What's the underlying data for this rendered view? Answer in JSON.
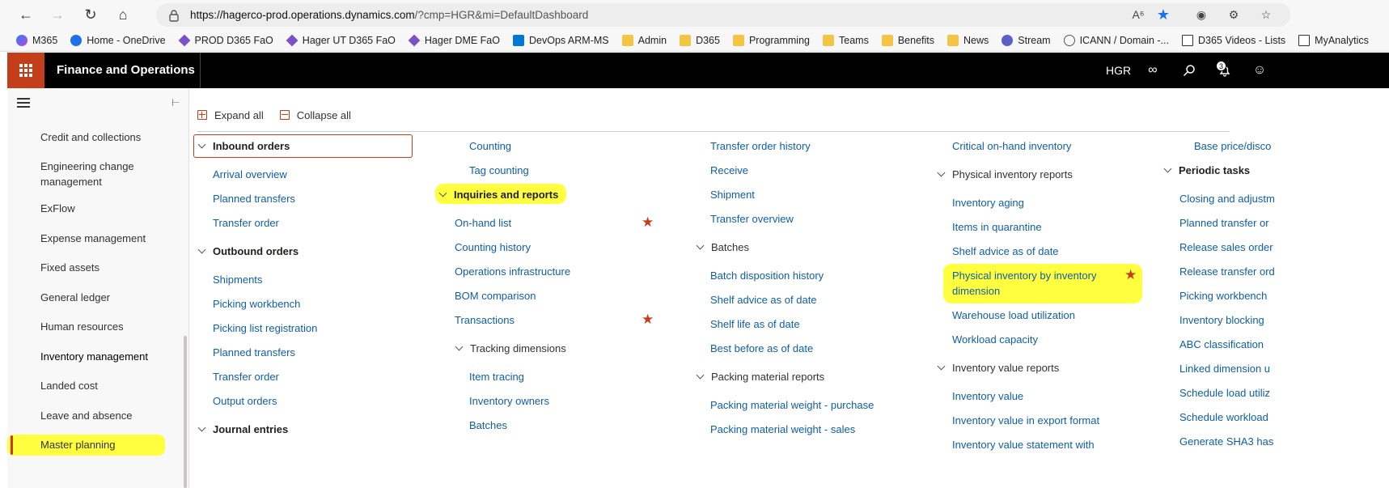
{
  "browser": {
    "url_host": "https://hagerco-prod.operations.dynamics.com",
    "url_path": "/?cmp=HGR&mi=DefaultDashboard",
    "bookmarks": [
      "M365",
      "Home - OneDrive",
      "PROD D365 FaO",
      "Hager UT D365 FaO",
      "Hager DME FaO",
      "DevOps ARM-MS",
      "Admin",
      "D365",
      "Programming",
      "Teams",
      "Benefits",
      "News",
      "Stream",
      "ICANN / Domain -...",
      "D365 Videos - Lists",
      "MyAnalytics"
    ]
  },
  "header": {
    "app_title": "Finance and Operations",
    "company": "HGR",
    "notification_count": "3"
  },
  "navpane": {
    "items": [
      "Credit and collections",
      "Engineering change management",
      "ExFlow",
      "Expense management",
      "Fixed assets",
      "General ledger",
      "Human resources",
      "Inventory management",
      "Landed cost",
      "Leave and absence",
      "Master planning"
    ]
  },
  "toolbar": {
    "expand_all": "Expand all",
    "collapse_all": "Collapse all"
  },
  "columns": {
    "col1": {
      "inbound_orders": "Inbound orders",
      "inbound_links": [
        "Arrival overview",
        "Planned transfers",
        "Transfer order"
      ],
      "outbound_orders": "Outbound orders",
      "outbound_links": [
        "Shipments",
        "Picking workbench",
        "Picking list registration",
        "Planned transfers",
        "Transfer order",
        "Output orders"
      ],
      "journal_entries": "Journal entries"
    },
    "col2": {
      "top_links": [
        "Counting",
        "Tag counting"
      ],
      "inquiries": "Inquiries and reports",
      "inquiry_links": [
        "On-hand list",
        "Counting history",
        "Operations infrastructure",
        "BOM comparison",
        "Transactions"
      ],
      "tracking": "Tracking dimensions",
      "tracking_links": [
        "Item tracing",
        "Inventory owners",
        "Batches"
      ]
    },
    "col3": {
      "top_links": [
        "Transfer order history",
        "Receive",
        "Shipment",
        "Transfer overview"
      ],
      "batches": "Batches",
      "batch_links": [
        "Batch disposition history",
        "Shelf advice as of date",
        "Shelf life as of date",
        "Best before as of date"
      ],
      "packing": "Packing material reports",
      "packing_links": [
        "Packing material weight - purchase",
        "Packing material weight - sales"
      ]
    },
    "col4": {
      "top_link": "Critical on-hand inventory",
      "physical": "Physical inventory reports",
      "physical_links": [
        "Inventory aging",
        "Items in quarantine",
        "Shelf advice as of date"
      ],
      "physical_by_dim_1": "Physical inventory by inventory",
      "physical_by_dim_2": "dimension",
      "physical_links_2": [
        "Warehouse load utilization",
        "Workload capacity"
      ],
      "value": "Inventory value reports",
      "value_links": [
        "Inventory value",
        "Inventory value in export format",
        "Inventory value statement with"
      ]
    },
    "col5": {
      "top_link": "Base price/disco",
      "periodic": "Periodic tasks",
      "periodic_links": [
        "Closing and adjustm",
        "Planned transfer or",
        "Release sales order",
        "Release transfer ord",
        "Picking workbench",
        "Inventory blocking",
        "ABC classification",
        "Linked dimension u",
        "Schedule load utiliz",
        "Schedule workload",
        "Generate SHA3 has"
      ]
    }
  }
}
